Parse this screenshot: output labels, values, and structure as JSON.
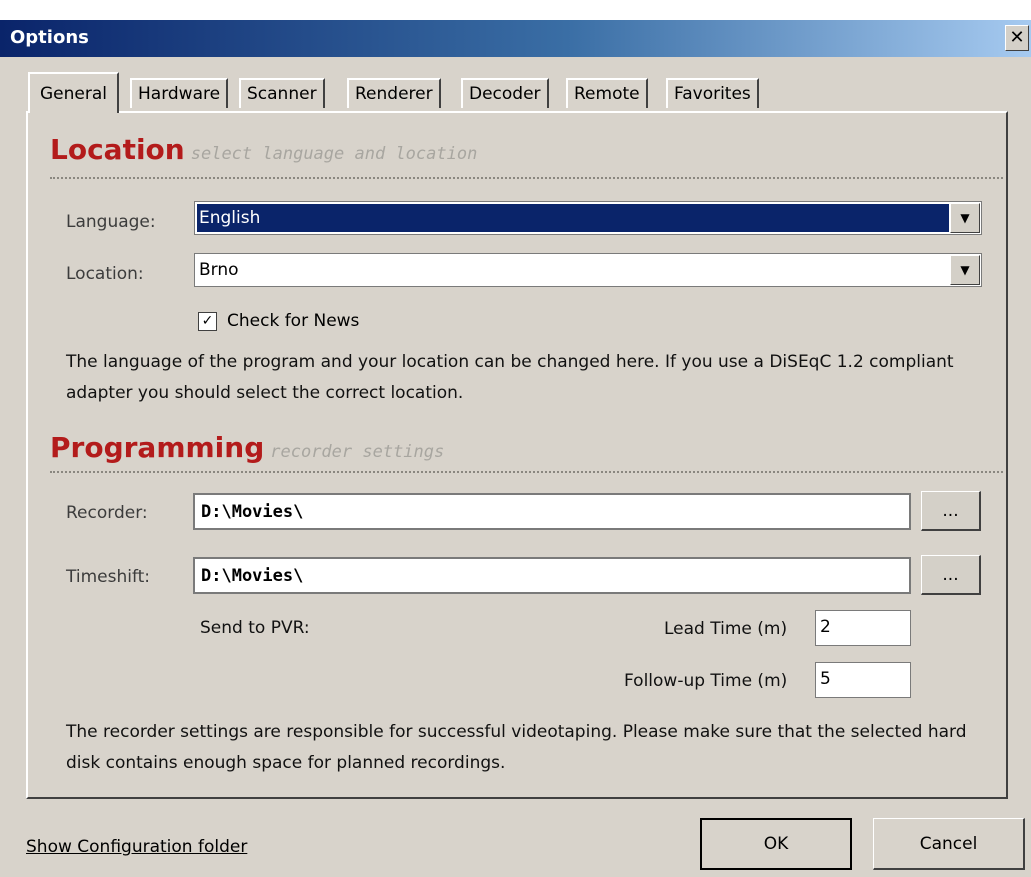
{
  "window": {
    "title": "Options",
    "close_glyph": "✕"
  },
  "tabs": [
    {
      "label": "General",
      "active": true
    },
    {
      "label": "Hardware"
    },
    {
      "label": "Scanner"
    },
    {
      "label": "Renderer"
    },
    {
      "label": "Decoder"
    },
    {
      "label": "Remote"
    },
    {
      "label": "Favorites"
    }
  ],
  "location_section": {
    "title": "Location",
    "subtitle": "select language and location",
    "language_label": "Language:",
    "language_value": "English",
    "location_label": "Location:",
    "location_value": "Brno",
    "check_news_label": "Check for News",
    "check_news_checked": true,
    "description": "The language of the program and your location can be changed here. If you use a DiSEqC 1.2 compliant adapter you should select the correct location."
  },
  "programming_section": {
    "title": "Programming",
    "subtitle": "recorder settings",
    "recorder_label": "Recorder:",
    "recorder_value": "D:\\Movies\\",
    "timeshift_label": "Timeshift:",
    "timeshift_value": "D:\\Movies\\",
    "browse_label": "...",
    "send_to_pvr_label": "Send to PVR:",
    "lead_time_label": "Lead Time (m)",
    "lead_time_value": "2",
    "follow_up_label": "Follow-up Time (m)",
    "follow_up_value": "5",
    "description": "The recorder settings are responsible for successful videotaping. Please make sure that the selected hard disk contains enough space for planned recordings."
  },
  "footer": {
    "config_link": "Show Configuration folder",
    "ok_label": "OK",
    "cancel_label": "Cancel"
  },
  "colors": {
    "section_title": "#b31b1b",
    "selection": "#0a246a"
  }
}
